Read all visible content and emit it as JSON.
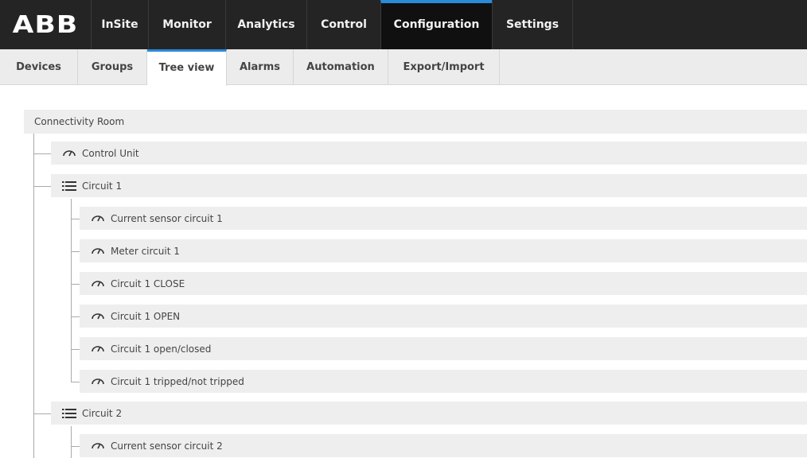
{
  "brand": {
    "logo_text": "ABB"
  },
  "top_nav": {
    "items": [
      {
        "label": "InSite"
      },
      {
        "label": "Monitor"
      },
      {
        "label": "Analytics"
      },
      {
        "label": "Control"
      },
      {
        "label": "Configuration",
        "active": true
      },
      {
        "label": "Settings"
      }
    ]
  },
  "sub_nav": {
    "items": [
      {
        "label": "Devices"
      },
      {
        "label": "Groups"
      },
      {
        "label": "Tree view",
        "active": true
      },
      {
        "label": "Alarms"
      },
      {
        "label": "Automation"
      },
      {
        "label": "Export/Import"
      }
    ]
  },
  "tree": {
    "root": "Connectivity Room",
    "nodes": [
      {
        "label": "Control Unit",
        "icon": "gauge-icon"
      },
      {
        "label": "Circuit 1",
        "icon": "list-icon"
      },
      {
        "label": "Current sensor circuit 1",
        "icon": "gauge-icon"
      },
      {
        "label": "Meter circuit 1",
        "icon": "gauge-icon"
      },
      {
        "label": "Circuit 1 CLOSE",
        "icon": "gauge-icon"
      },
      {
        "label": "Circuit 1 OPEN",
        "icon": "gauge-icon"
      },
      {
        "label": "Circuit 1 open/closed",
        "icon": "gauge-icon"
      },
      {
        "label": "Circuit 1 tripped/not tripped",
        "icon": "gauge-icon"
      },
      {
        "label": "Circuit 2",
        "icon": "list-icon"
      },
      {
        "label": "Current sensor circuit 2",
        "icon": "gauge-icon"
      }
    ]
  },
  "colors": {
    "accent": "#2a8ad8",
    "topbar": "#242424",
    "row_bg": "#eeeeee"
  }
}
